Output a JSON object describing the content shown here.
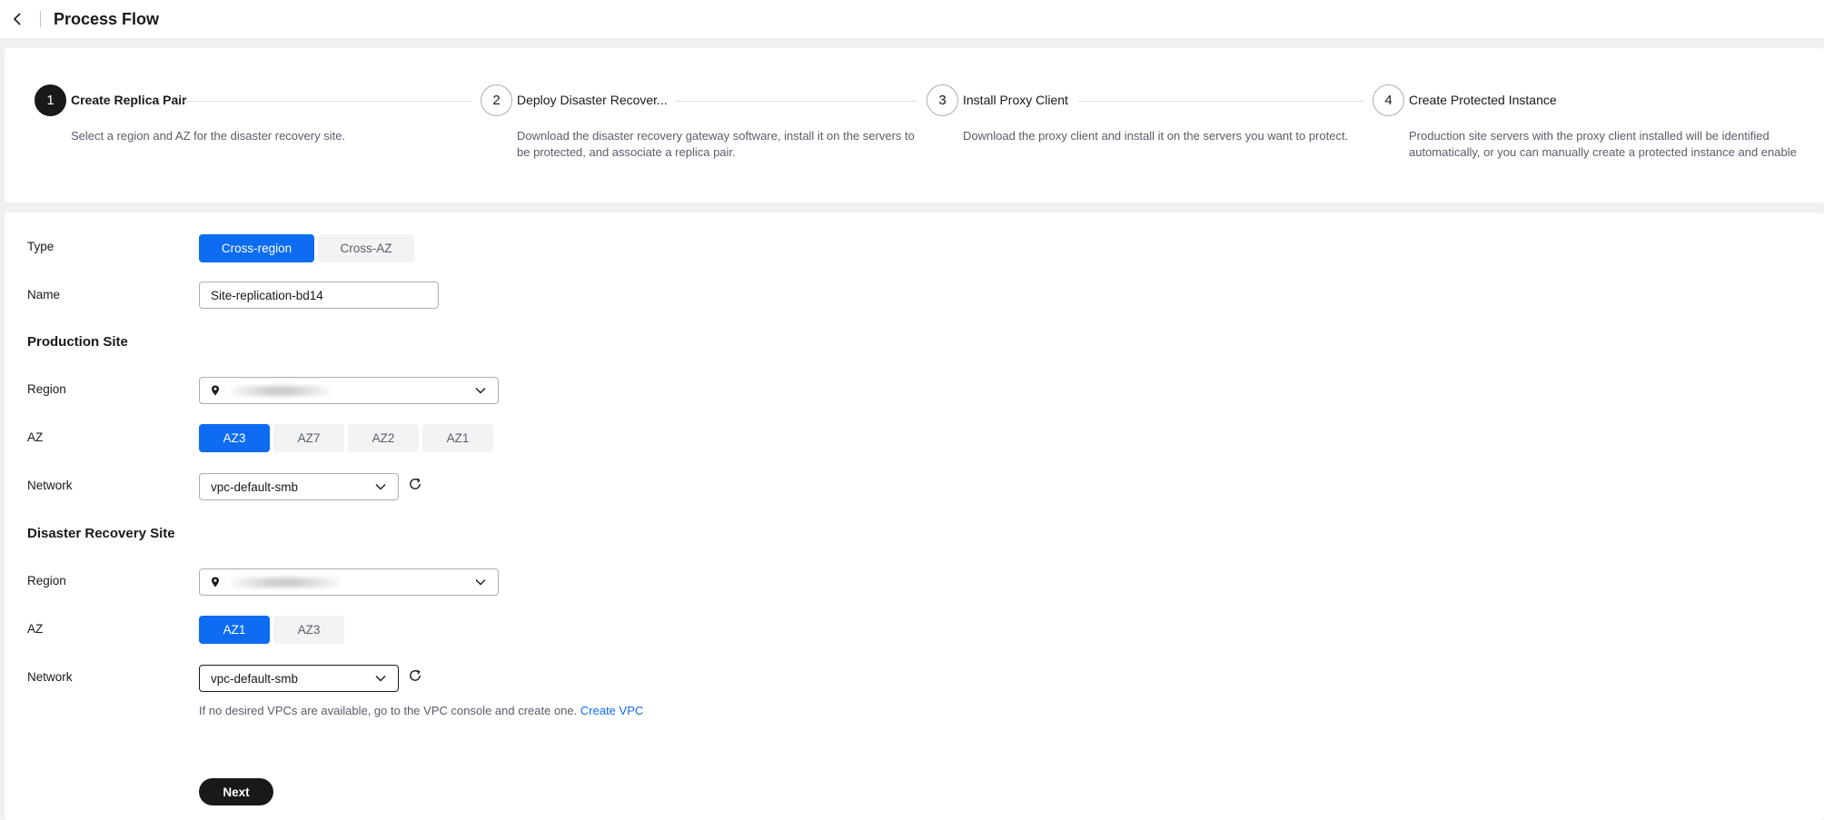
{
  "header": {
    "title": "Process Flow"
  },
  "steps": [
    {
      "number": "1",
      "title": "Create Replica Pair",
      "description": "Select a region and AZ for the disaster recovery site.",
      "active": true
    },
    {
      "number": "2",
      "title": "Deploy Disaster Recover...",
      "description": "Download the disaster recovery gateway software, install it on the servers to be protected, and associate a replica pair.",
      "active": false
    },
    {
      "number": "3",
      "title": "Install Proxy Client",
      "description": "Download the proxy client and install it on the servers you want to protect.",
      "active": false
    },
    {
      "number": "4",
      "title": "Create Protected Instance",
      "description": "Production site servers with the proxy client installed will be identified automatically, or you can manually create a protected instance and enable pr...",
      "active": false
    }
  ],
  "form": {
    "type": {
      "label": "Type",
      "options": [
        "Cross-region",
        "Cross-AZ"
      ],
      "selected": "Cross-region"
    },
    "name": {
      "label": "Name",
      "value": "Site-replication-bd14"
    },
    "production": {
      "title": "Production Site",
      "region_label": "Region",
      "az_label": "AZ",
      "az_options": [
        "AZ3",
        "AZ7",
        "AZ2",
        "AZ1"
      ],
      "az_selected": "AZ3",
      "network_label": "Network",
      "network_value": "vpc-default-smb"
    },
    "dr": {
      "title": "Disaster Recovery Site",
      "region_label": "Region",
      "az_label": "AZ",
      "az_options": [
        "AZ1",
        "AZ3"
      ],
      "az_selected": "AZ1",
      "network_label": "Network",
      "network_value": "vpc-default-smb"
    },
    "hint_text": "If no desired VPCs are available, go to the VPC console and create one.",
    "hint_link": "Create VPC",
    "next_label": "Next"
  },
  "colors": {
    "primary": "#0d6cf2",
    "dark": "#191919",
    "background": "#f0f0f0"
  },
  "icons": {
    "back": "chevron-left-icon",
    "location": "location-pin-icon",
    "dropdown": "chevron-down-icon",
    "refresh": "refresh-icon"
  }
}
